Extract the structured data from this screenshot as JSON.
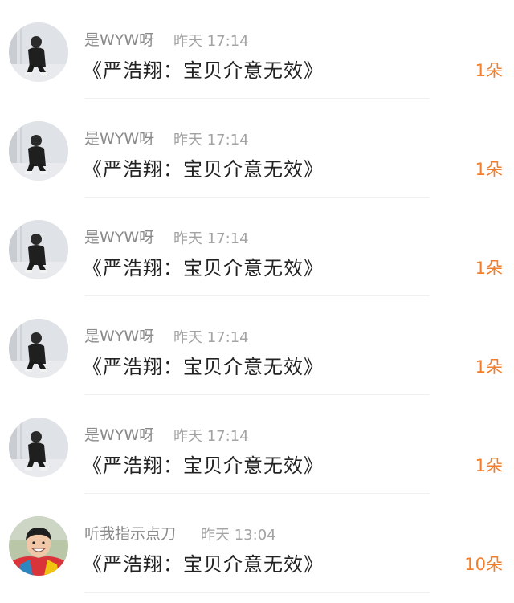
{
  "comments": [
    {
      "user": "是WYW呀",
      "time": "昨天 17:14",
      "text": "《严浩翔：宝贝介意无效》",
      "flowers": "1朵",
      "avatar": "person-squatting-avatar"
    },
    {
      "user": "是WYW呀",
      "time": "昨天 17:14",
      "text": "《严浩翔：宝贝介意无效》",
      "flowers": "1朵",
      "avatar": "person-squatting-avatar"
    },
    {
      "user": "是WYW呀",
      "time": "昨天 17:14",
      "text": "《严浩翔：宝贝介意无效》",
      "flowers": "1朵",
      "avatar": "person-squatting-avatar"
    },
    {
      "user": "是WYW呀",
      "time": "昨天 17:14",
      "text": "《严浩翔：宝贝介意无效》",
      "flowers": "1朵",
      "avatar": "person-squatting-avatar"
    },
    {
      "user": "是WYW呀",
      "time": "昨天 17:14",
      "text": "《严浩翔：宝贝介意无效》",
      "flowers": "1朵",
      "avatar": "person-squatting-avatar"
    },
    {
      "user": "听我指示点刀",
      "time": "昨天 13:04",
      "text": "《严浩翔：宝贝介意无效》",
      "flowers": "10朵",
      "avatar": "smiling-face-avatar"
    }
  ],
  "colors": {
    "flower_accent": "#f27e2c",
    "username": "#8a8a8a",
    "timestamp": "#a3a3a3",
    "message": "#222222"
  }
}
